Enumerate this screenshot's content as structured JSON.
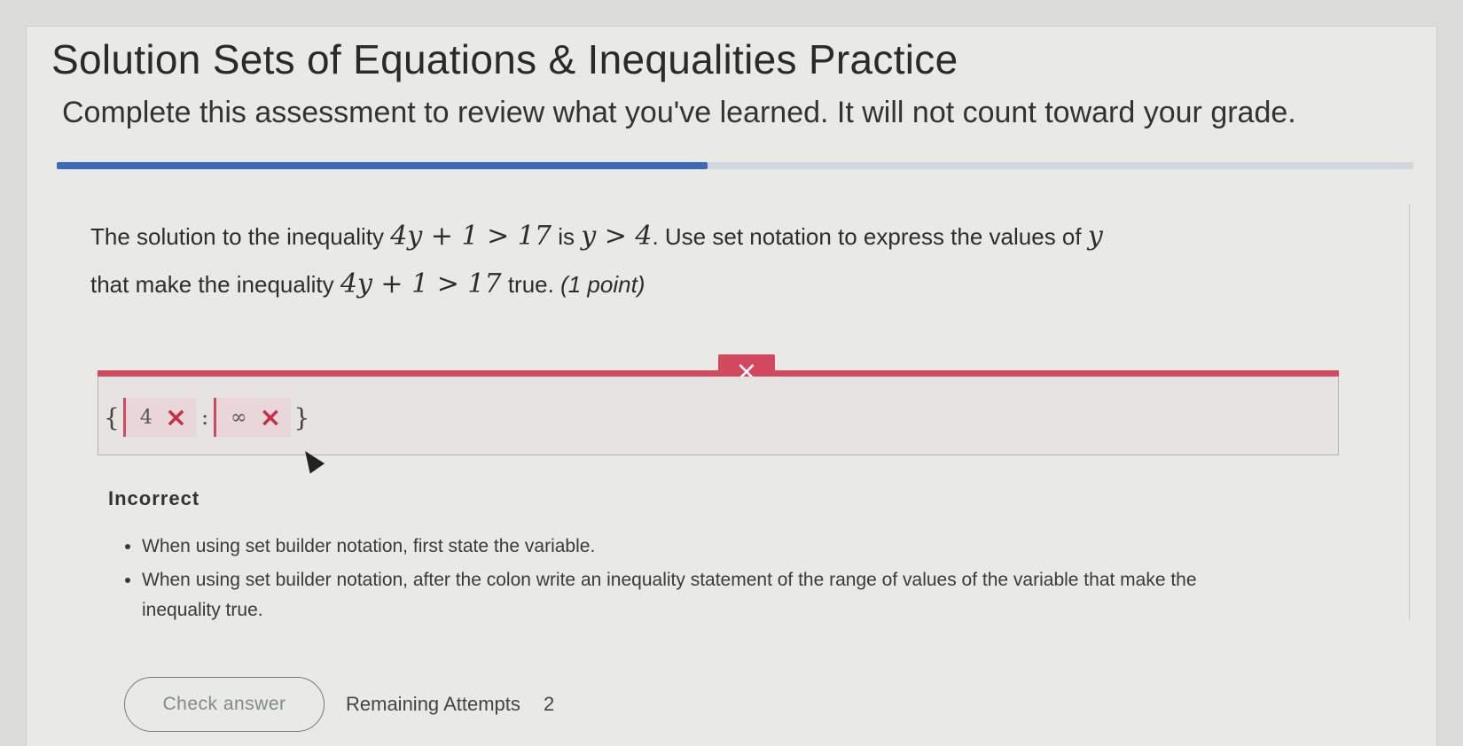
{
  "header": {
    "title": "Solution Sets of Equations & Inequalities Practice",
    "subtitle": "Complete this assessment to review what you've learned. It will not count toward your grade."
  },
  "progress": {
    "fraction": 0.48
  },
  "question": {
    "text_1": "The solution to the inequality",
    "math_1": "4y + 1 > 17",
    "text_2": "is",
    "math_2": "y > 4",
    "text_3": ". Use set notation to express the values of",
    "var": "y",
    "text_4": "that make the inequality",
    "math_3": "4y + 1 > 17",
    "text_5": "true.",
    "points": "(1 point)"
  },
  "answer": {
    "clear_icon": "×",
    "open_brace": "{",
    "slot_1_value": "4",
    "slot_remove_icon": "×",
    "colon": ":",
    "slot_2_value": "∞",
    "close_brace": "}"
  },
  "feedback": {
    "title": "Incorrect",
    "hints": [
      "When using set builder notation, first state the variable.",
      "When using set builder notation, after the colon write an inequality statement of the range of values of the variable that make the inequality true."
    ]
  },
  "footer": {
    "check_label": "Check answer",
    "attempts_label": "Remaining Attempts",
    "attempts_count": "2"
  },
  "colors": {
    "error": "#d2485f",
    "progress": "#3d6ab8"
  }
}
